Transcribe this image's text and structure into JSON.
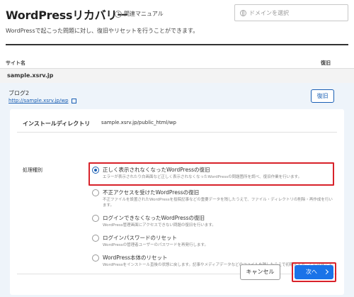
{
  "header": {
    "title": "WordPressリカバリー",
    "manual_label": "関連マニュアル",
    "domain_placeholder": "ドメインを選択",
    "subtitle": "WordPressで起こった問題に対し、復旧やリセットを行うことができます。"
  },
  "table": {
    "col_site": "サイト名",
    "col_restore": "復旧",
    "site": "sample.xsrv.jp"
  },
  "blog": {
    "name": "ブログ2",
    "url": "http://sample.xsrv.jp/wp",
    "restore_label": "復旧"
  },
  "panel": {
    "install_label": "インストールディレクトリ",
    "install_value": "sample.xsrv.jp/public_html/wp",
    "process_label": "処理種別",
    "options": [
      {
        "title": "正しく表示されなくなったWordPressの復旧",
        "desc": "エラーが表示されたり白画面など正しく表示されなくなったWordPressの問題箇所を調べ、復旧作業を行います。",
        "checked": true
      },
      {
        "title": "不正アクセスを受けたWordPressの復旧",
        "desc": "不正ファイルを設置されたWordPressを投稿記事などの重要データを残したうえで、ファイル・ディレクトリの削除・再作成を行います。",
        "checked": false
      },
      {
        "title": "ログインできなくなったWordPressの復旧",
        "desc": "WordPress管理画面にアクセスできない問題の復旧を行います。",
        "checked": false
      },
      {
        "title": "ログインパスワードのリセット",
        "desc": "WordPressの管理者ユーザーのパスワードを再発行します。",
        "checked": false
      },
      {
        "title": "WordPress本体のリセット",
        "desc": "WordPressをインストール直後の状態に戻します。記事やメディアデータなどのファイルを残したうえで初期化することも可能です。",
        "checked": false
      }
    ],
    "cancel_label": "キャンセル",
    "next_label": "次へ"
  },
  "colors": {
    "accent": "#1a73e8",
    "link": "#1a5fb4",
    "highlight": "#d8222a"
  }
}
